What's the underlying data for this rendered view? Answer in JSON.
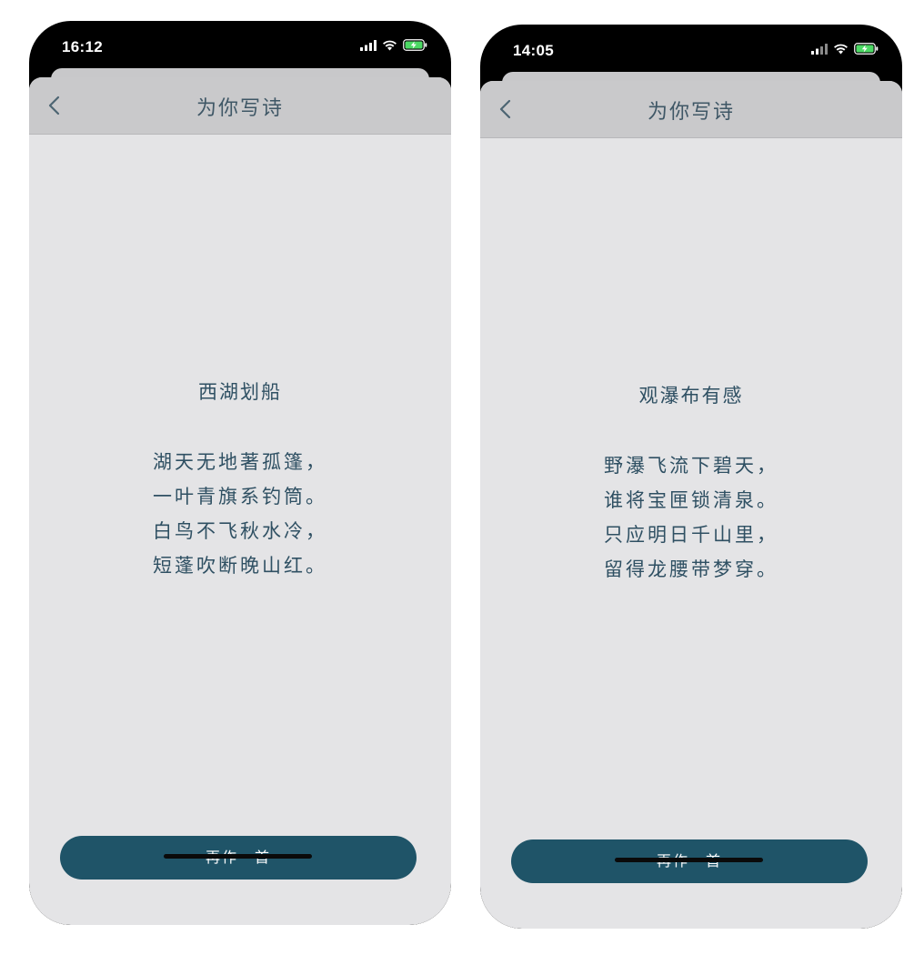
{
  "screens": [
    {
      "status": {
        "time": "16:12"
      },
      "nav": {
        "title": "为你写诗",
        "back_icon": "chevron-left"
      },
      "poem": {
        "title": "西湖划船",
        "lines": [
          "湖天无地著孤篷，",
          "一叶青旗系钓筒。",
          "白鸟不飞秋水冷，",
          "短蓬吹断晚山红。"
        ]
      },
      "action": {
        "label": "再作一首"
      }
    },
    {
      "status": {
        "time": "14:05"
      },
      "nav": {
        "title": "为你写诗",
        "back_icon": "chevron-left"
      },
      "poem": {
        "title": "观瀑布有感",
        "lines": [
          "野瀑飞流下碧天，",
          "谁将宝匣锁清泉。",
          "只应明日千山里，",
          "留得龙腰带梦穿。"
        ]
      },
      "action": {
        "label": "再作一首"
      }
    }
  ],
  "colors": {
    "accent": "#1f5468",
    "poem_text": "#2f5063",
    "sheet_bg": "#e4e4e6",
    "nav_bg": "#c9c9cb",
    "battery": "#4cd964"
  }
}
